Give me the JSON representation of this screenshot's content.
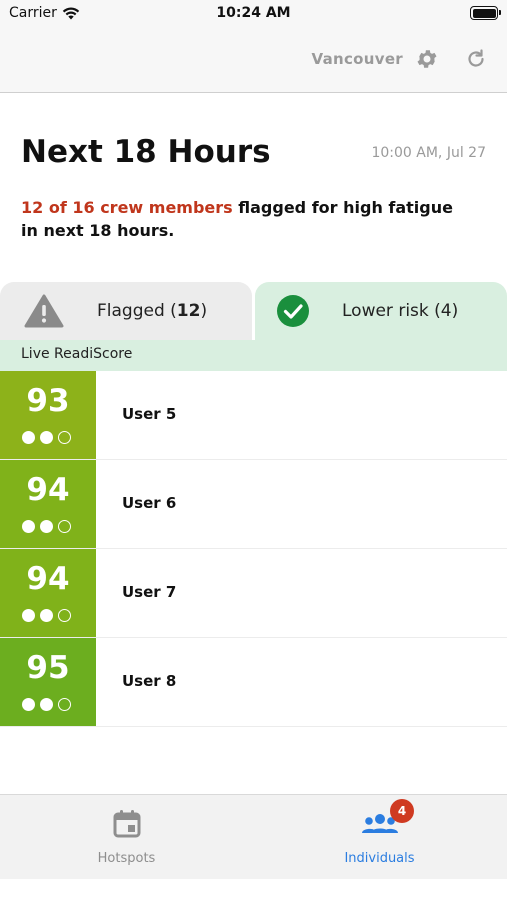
{
  "status_bar": {
    "carrier": "Carrier",
    "time": "10:24 AM"
  },
  "top_bar": {
    "location": "Vancouver",
    "icons": [
      "gear-icon",
      "refresh-icon"
    ]
  },
  "header": {
    "title": "Next 18 Hours",
    "timestamp": "10:00 AM, Jul 27",
    "summary_highlight": "12 of 16 crew members",
    "summary_rest": " flagged for high fatigue in next 18 hours.",
    "highlight_color": "#c0361c"
  },
  "tabs": {
    "flagged": {
      "label": "Flagged (",
      "count": "12",
      "suffix": ")",
      "icon": "warning-icon"
    },
    "lower_risk": {
      "label": "Lower risk (4)",
      "icon": "check-circle-icon",
      "selected": true
    }
  },
  "section_label": "Live ReadiScore",
  "rows": [
    {
      "score": "93",
      "name": "User 5",
      "dots_filled": 2,
      "dots_total": 3,
      "color": "#8db21a"
    },
    {
      "score": "94",
      "name": "User 6",
      "dots_filled": 2,
      "dots_total": 3,
      "color": "#80b21a"
    },
    {
      "score": "94",
      "name": "User 7",
      "dots_filled": 2,
      "dots_total": 3,
      "color": "#80b21a"
    },
    {
      "score": "95",
      "name": "User 8",
      "dots_filled": 2,
      "dots_total": 3,
      "color": "#6cae1f"
    }
  ],
  "tab_bar": {
    "hotspots_label": "Hotspots",
    "individuals_label": "Individuals",
    "individuals_badge": "4",
    "active_color": "#2b7de0",
    "badge_color": "#cf3a21"
  }
}
